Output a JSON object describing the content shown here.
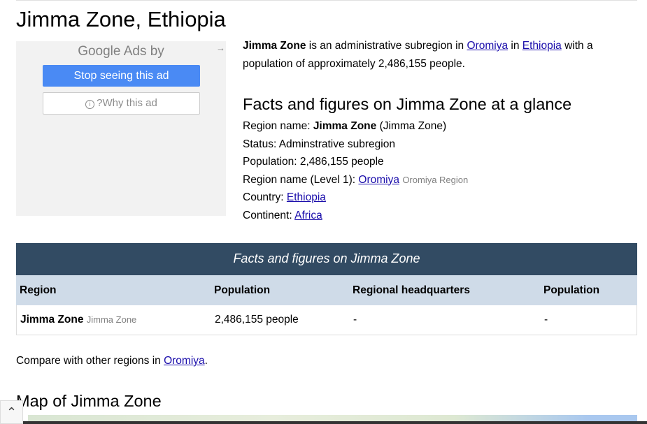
{
  "page": {
    "title": "Jimma Zone, Ethiopia"
  },
  "ad": {
    "header": "Google Ads by",
    "arrow_icon": "arrow-right-icon",
    "stop_label": "Stop seeing this ad",
    "why_label": "?Why this ad",
    "info_icon": "info-icon"
  },
  "intro": {
    "region_bold": "Jimma Zone",
    "text1": " is an administrative subregion in ",
    "link_region": "Oromiya",
    "text2": " in ",
    "link_country": "Ethiopia",
    "text3": " with a population of approximately 2,486,155 people."
  },
  "facts": {
    "heading": "Facts and figures on Jimma Zone at a glance",
    "region_name_label": "Region name: ",
    "region_name_value": "Jimma Zone",
    "region_name_alt": " (Jimma Zone)",
    "status": "Status: Adminstrative subregion",
    "population": "Population: 2,486,155 people",
    "level1_label": "Region name (Level 1): ",
    "level1_link": "Oromiya",
    "level1_alt": "Oromiya Region",
    "country_label": "Country: ",
    "country_link": "Ethiopia",
    "continent_label": "Continent: ",
    "continent_link": "Africa"
  },
  "table": {
    "title": "Facts and figures on Jimma Zone",
    "headers": [
      "Region",
      "Population",
      "Regional headquarters",
      "Population"
    ],
    "row": {
      "region": "Jimma Zone",
      "region_alt": "Jimma Zone",
      "population": "2,486,155 people",
      "headquarters": "-",
      "hq_population": "-"
    }
  },
  "compare": {
    "text": "Compare with other regions in ",
    "link": "Oromiya",
    "end": "."
  },
  "map": {
    "heading": "Map of Jimma Zone"
  },
  "scroll_top": {
    "icon": "chevron-up-icon"
  },
  "colors": {
    "table_title_bg": "#324b63",
    "table_head_bg": "#cfdbe8",
    "ad_button": "#4a8af4",
    "link": "#1a0dab"
  }
}
